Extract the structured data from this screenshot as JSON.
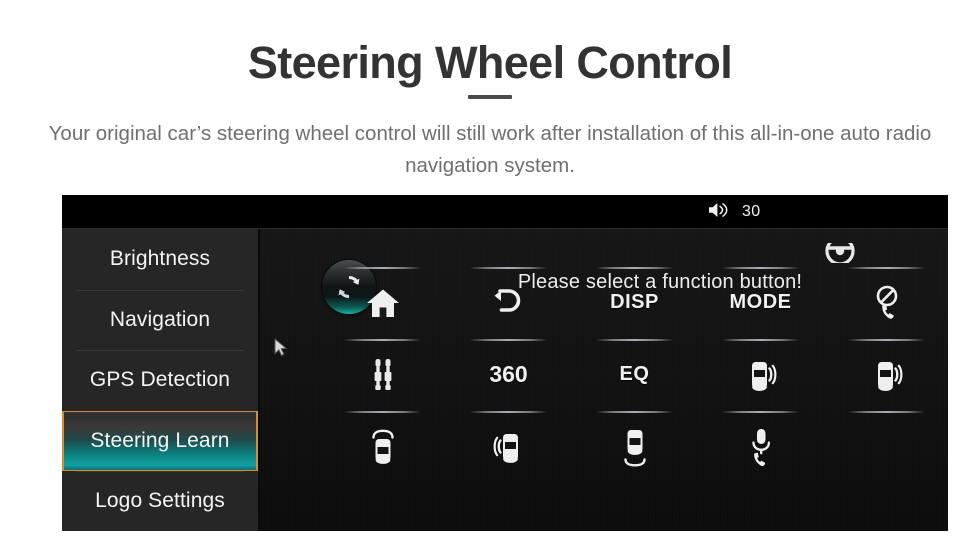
{
  "hero": {
    "title": "Steering Wheel Control",
    "subtitle": "Your original car’s steering wheel control will still work after installation of this all-in-one auto radio navigation system."
  },
  "device": {
    "status_bar": {
      "speaker_icon": "speaker-icon",
      "volume_value": "30"
    },
    "sidebar": {
      "items": [
        {
          "label": "Brightness",
          "active": false
        },
        {
          "label": "Navigation",
          "active": false
        },
        {
          "label": "GPS Detection",
          "active": false
        },
        {
          "label": "Steering Learn",
          "active": true
        },
        {
          "label": "Logo Settings",
          "active": false
        }
      ]
    },
    "main": {
      "sync_button_icon": "refresh-sync-icon",
      "prompt": "Please select a function button!",
      "cursor_icon": "mouse-cursor",
      "grid": {
        "columns": 5,
        "rows": 3,
        "cells": [
          {
            "row": 0,
            "col": 0,
            "type": "icon",
            "icon": "home-icon",
            "label": "Home"
          },
          {
            "row": 0,
            "col": 1,
            "type": "icon",
            "icon": "back-arrow-icon",
            "label": "Back"
          },
          {
            "row": 0,
            "col": 2,
            "type": "text",
            "icon": "disp-label",
            "label": "DISP"
          },
          {
            "row": 0,
            "col": 3,
            "type": "text",
            "icon": "mode-label",
            "label": "MODE"
          },
          {
            "row": 0,
            "col": 4,
            "type": "icon",
            "icon": "hang-up-phone-icon",
            "label": "Hang Up"
          },
          {
            "row": 1,
            "col": 0,
            "type": "icon",
            "icon": "aux-jack-icon",
            "label": "AUX"
          },
          {
            "row": 1,
            "col": 1,
            "type": "text",
            "icon": "360-label",
            "label": "360"
          },
          {
            "row": 1,
            "col": 2,
            "type": "text",
            "icon": "eq-label",
            "label": "EQ"
          },
          {
            "row": 1,
            "col": 3,
            "type": "icon",
            "icon": "car-right-sensor-icon",
            "label": "Right Sensor"
          },
          {
            "row": 1,
            "col": 4,
            "type": "icon",
            "icon": "car-right-sensor-icon",
            "label": "Right Sensor"
          },
          {
            "row": 2,
            "col": 0,
            "type": "icon",
            "icon": "car-front-sensor-icon",
            "label": "Front Sensor"
          },
          {
            "row": 2,
            "col": 1,
            "type": "icon",
            "icon": "car-left-sensor-icon",
            "label": "Left Sensor"
          },
          {
            "row": 2,
            "col": 2,
            "type": "icon",
            "icon": "car-rear-sensor-icon",
            "label": "Rear Sensor"
          },
          {
            "row": 2,
            "col": 3,
            "type": "icon",
            "icon": "voice-call-icon",
            "label": "Voice Call"
          },
          {
            "row": 2,
            "col": 4,
            "type": "empty",
            "icon": "",
            "label": ""
          }
        ],
        "partial_top_cell": {
          "col": 4,
          "icon": "steering-wheel-icon",
          "label": "Steering Wheel"
        }
      }
    }
  },
  "colors": {
    "page_bg": "#ffffff",
    "title": "#333333",
    "subtitle": "#6f6f6f",
    "device_bg": "#141414",
    "status_bar_bg": "#000000",
    "sidebar_bg": "#262626",
    "active_teal": "#13a0a0",
    "active_border": "#c98f38",
    "glyph": "#f2f2f2"
  }
}
